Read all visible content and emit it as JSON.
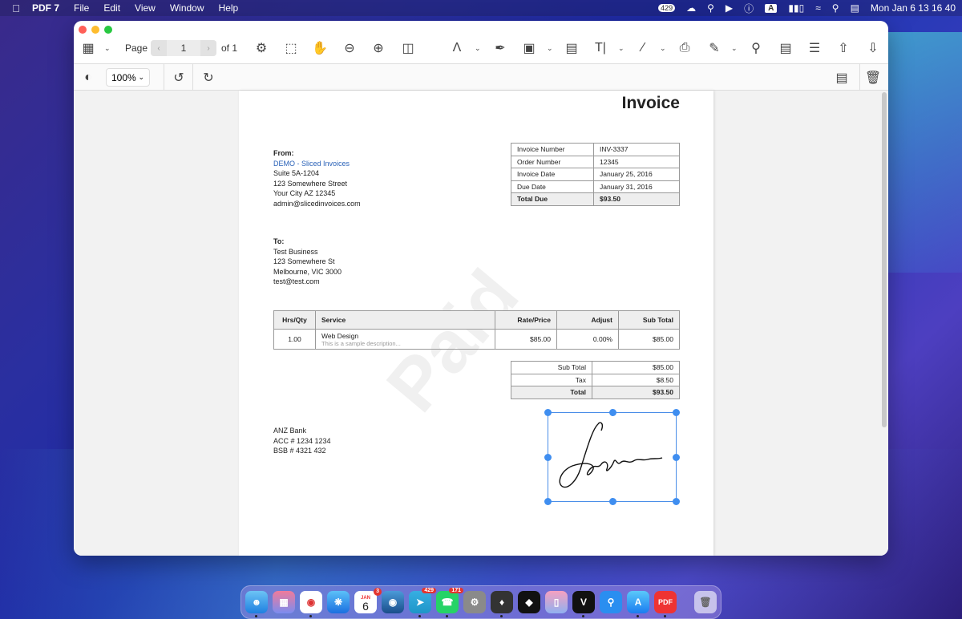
{
  "menubar": {
    "app_name": "PDF 7",
    "items": [
      "File",
      "Edit",
      "View",
      "Window",
      "Help"
    ],
    "badge_count": "429",
    "input_source": "A",
    "clock": "Mon Jan 6  13 16 40"
  },
  "toolbar": {
    "page_label": "Page",
    "page_number": "1",
    "page_total": "of 1",
    "zoom_level": "100%"
  },
  "invoice": {
    "title": "Invoice",
    "from_label": "From:",
    "from_name": "DEMO - Sliced Invoices",
    "from_lines": [
      "Suite 5A-1204",
      "123 Somewhere Street",
      "Your City AZ 12345",
      "admin@slicedinvoices.com"
    ],
    "to_label": "To:",
    "to_lines": [
      "Test Business",
      "123 Somewhere St",
      "Melbourne, VIC 3000",
      "test@test.com"
    ],
    "meta": [
      {
        "label": "Invoice Number",
        "value": "INV-3337"
      },
      {
        "label": "Order Number",
        "value": "12345"
      },
      {
        "label": "Invoice Date",
        "value": "January 25, 2016"
      },
      {
        "label": "Due Date",
        "value": "January 31, 2016"
      },
      {
        "label": "Total Due",
        "value": "$93.50"
      }
    ],
    "columns": [
      "Hrs/Qty",
      "Service",
      "Rate/Price",
      "Adjust",
      "Sub Total"
    ],
    "rows": [
      {
        "qty": "1.00",
        "service": "Web Design",
        "description": "This is a sample description...",
        "rate": "$85.00",
        "adjust": "0.00%",
        "subtotal": "$85.00"
      }
    ],
    "totals": [
      {
        "label": "Sub Total",
        "value": "$85.00"
      },
      {
        "label": "Tax",
        "value": "$8.50"
      },
      {
        "label": "Total",
        "value": "$93.50"
      }
    ],
    "bank_lines": [
      "ANZ Bank",
      "ACC # 1234 1234",
      "BSB # 4321 432"
    ],
    "watermark": "Paid"
  },
  "dock": {
    "calendar_month": "JAN",
    "calendar_day": "6",
    "calendar_badge": "3",
    "telegram_badge": "429",
    "whatsapp_badge": "171",
    "pdf_label": "PDF"
  }
}
